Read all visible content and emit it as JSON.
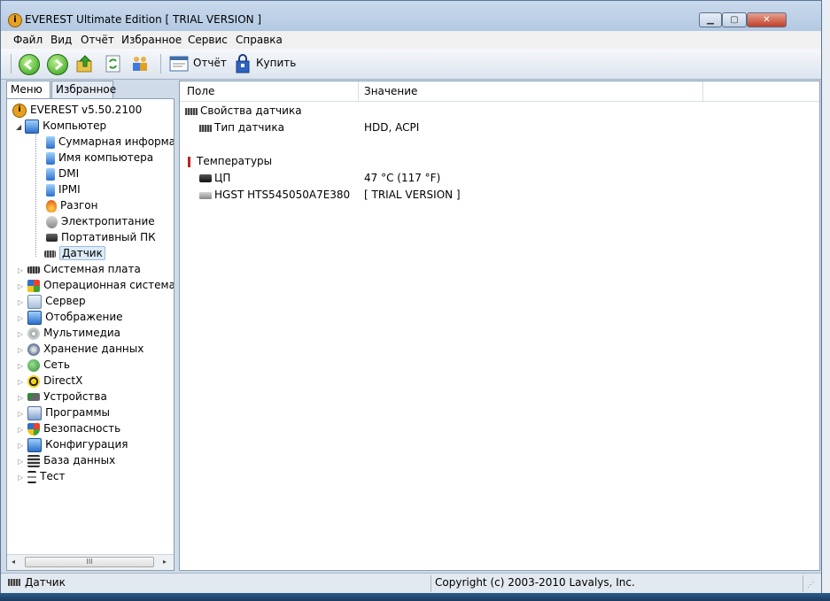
{
  "window": {
    "title": "EVEREST Ultimate Edition  [ TRIAL VERSION ]",
    "controls": {
      "minimize": "▁",
      "maximize": "▢",
      "close": "✕"
    }
  },
  "menu": [
    "Файл",
    "Вид",
    "Отчёт",
    "Избранное",
    "Сервис",
    "Справка"
  ],
  "toolbar": {
    "buttons": [
      "back-icon",
      "forward-icon",
      "up-icon",
      "refresh-icon",
      "users-icon"
    ],
    "report_label": "Отчёт",
    "buy_label": "Купить"
  },
  "left_tabs": {
    "menu": "Меню",
    "favorites": "Избранное"
  },
  "tree": {
    "root": "EVEREST v5.50.2100",
    "computer": "Компьютер",
    "computer_children": [
      "Суммарная информа",
      "Имя компьютера",
      "DMI",
      "IPMI",
      "Разгон",
      "Электропитание",
      "Портативный ПК",
      "Датчик"
    ],
    "sections": [
      "Системная плата",
      "Операционная система",
      "Сервер",
      "Отображение",
      "Мультимедиа",
      "Хранение данных",
      "Сеть",
      "DirectX",
      "Устройства",
      "Программы",
      "Безопасность",
      "Конфигурация",
      "База данных",
      "Тест"
    ],
    "selected": "Датчик"
  },
  "grid": {
    "columns": {
      "field": "Поле",
      "value": "Значение"
    },
    "groups": [
      {
        "title": "Свойства датчика",
        "rows": [
          {
            "field": "Тип датчика",
            "value": "HDD, ACPI"
          }
        ]
      },
      {
        "title": "Температуры",
        "rows": [
          {
            "field": "ЦП",
            "value": "47 °C  (117 °F)"
          },
          {
            "field": "HGST HTS545050A7E380",
            "value": "[ TRIAL VERSION ]"
          }
        ]
      }
    ]
  },
  "status": {
    "left": "Датчик",
    "right": "Copyright (c) 2003-2010 Lavalys, Inc."
  },
  "scrollbar": {
    "thumb_glyph": "III",
    "left_arrow": "◂",
    "right_arrow": "▸"
  },
  "colors": {
    "accent": "#3e6fa8",
    "titlebar": "#b3c9e2",
    "close": "#c0402a"
  }
}
